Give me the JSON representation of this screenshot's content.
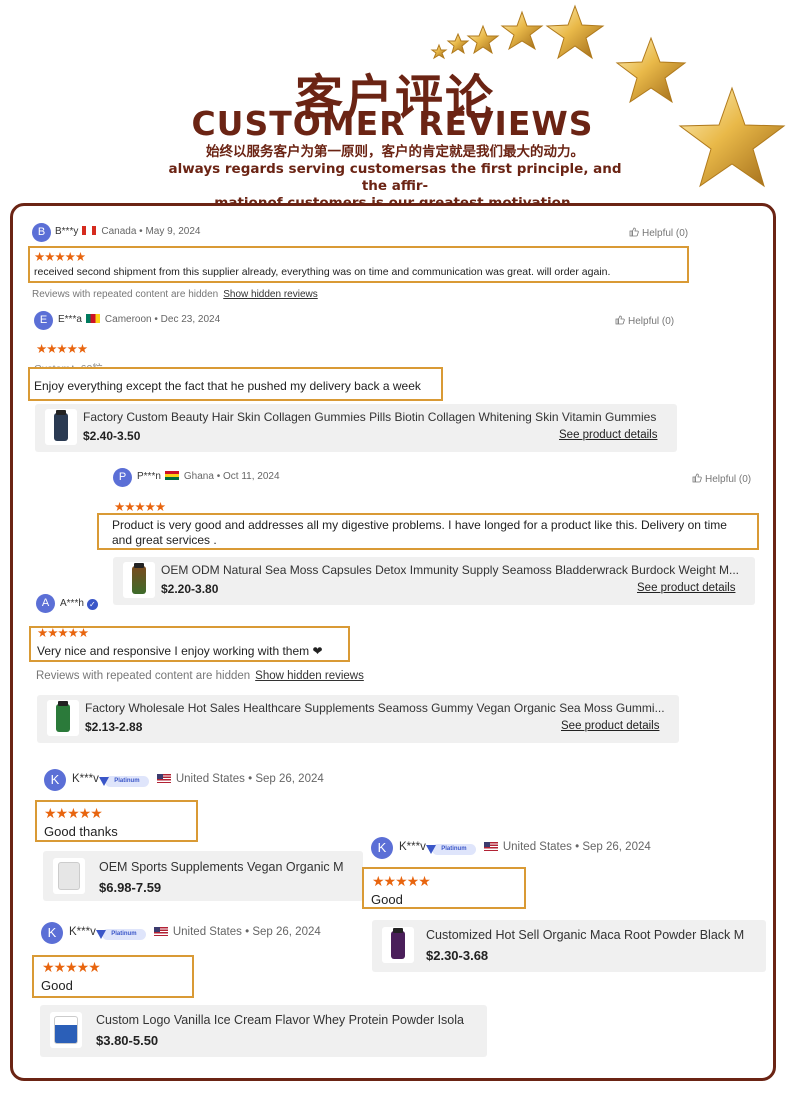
{
  "header": {
    "title_cn": "客户评论",
    "title_en": "CUSTOMER REVIEWS",
    "subtitle_cn": "始终以服务客户为第一原则，客户的肯定就是我们最大的动力。",
    "subtitle_en_1": "always regards serving customersas the first principle, and the affir-",
    "subtitle_en_2": "mationof customers is our greatest motivation."
  },
  "colors": {
    "brand_brown": "#6b2414",
    "star_orange": "#e8650f",
    "highlight_border": "#d99a35",
    "avatar_blue": "#5b6fd6"
  },
  "stars_symbol": "★★★★★",
  "hidden_note": {
    "text": "Reviews with repeated content are hidden",
    "link": "Show hidden reviews"
  },
  "see_details": "See product details",
  "custom_note": "Custom：60粒",
  "reviews": [
    {
      "initial": "B",
      "name": "B***y",
      "country": "Canada",
      "date": "• May 9, 2024",
      "helpful": "Helpful (0)",
      "rating": 5,
      "text": "received second shipment from this supplier already, everything was on time and communication was great. will order again."
    },
    {
      "initial": "E",
      "name": "E***a",
      "country": "Cameroon",
      "date": "• Dec 23, 2024",
      "helpful": "Helpful (0)",
      "rating": 5,
      "text": "Enjoy everything except the fact that he pushed my delivery back a week",
      "product": {
        "title": "Factory Custom Beauty Hair Skin Collagen Gummies Pills Biotin Collagen Whitening Skin Vitamin Gummies",
        "price": "$2.40-3.50",
        "icon": "supplement-bottle-icon"
      }
    },
    {
      "initial": "P",
      "name": "P***n",
      "country": "Ghana",
      "date": "• Oct 11, 2024",
      "helpful": "Helpful (0)",
      "rating": 5,
      "text_1": "Product is very good and addresses all my digestive problems. I have longed for a product like this. Delivery on time",
      "text_2": "and great services .",
      "product": {
        "title": "OEM ODM Natural Sea Moss Capsules Detox Immunity Supply Seamoss Bladderwrack Burdock Weight M...",
        "price": "$2.20-3.80",
        "icon": "sea-moss-bottle-icon"
      }
    },
    {
      "initial": "A",
      "name": "A***h",
      "rating": 5,
      "text": "Very nice and responsive I enjoy working with them ❤",
      "product": {
        "title": "Factory Wholesale Hot Sales Healthcare Supplements Seamoss Gummy Vegan Organic Sea Moss Gummi...",
        "price": "$2.13-2.88",
        "icon": "gummy-bottle-icon"
      }
    },
    {
      "initial": "K",
      "name": "K***v",
      "badge": "Platinum",
      "country": "United States",
      "date": "• Sep 26, 2024",
      "rating": 5,
      "text": "Good thanks",
      "product": {
        "title": "OEM Sports Supplements Vegan Organic M",
        "price": "$6.98-7.59",
        "icon": "powder-tub-icon"
      }
    },
    {
      "initial": "K",
      "name": "K***v",
      "badge": "Platinum",
      "country": "United States",
      "date": "• Sep 26, 2024",
      "rating": 5,
      "text": "Good",
      "product": {
        "title": "Customized Hot Sell Organic Maca Root Powder Black M",
        "price": "$2.30-3.68",
        "icon": "maca-bottle-icon"
      }
    },
    {
      "initial": "K",
      "name": "K***v",
      "badge": "Platinum",
      "country": "United States",
      "date": "• Sep 26, 2024",
      "rating": 5,
      "text": "Good",
      "product": {
        "title": "Custom Logo Vanilla Ice Cream Flavor Whey Protein Powder Isola",
        "price": "$3.80-5.50",
        "icon": "protein-tub-icon"
      }
    }
  ]
}
